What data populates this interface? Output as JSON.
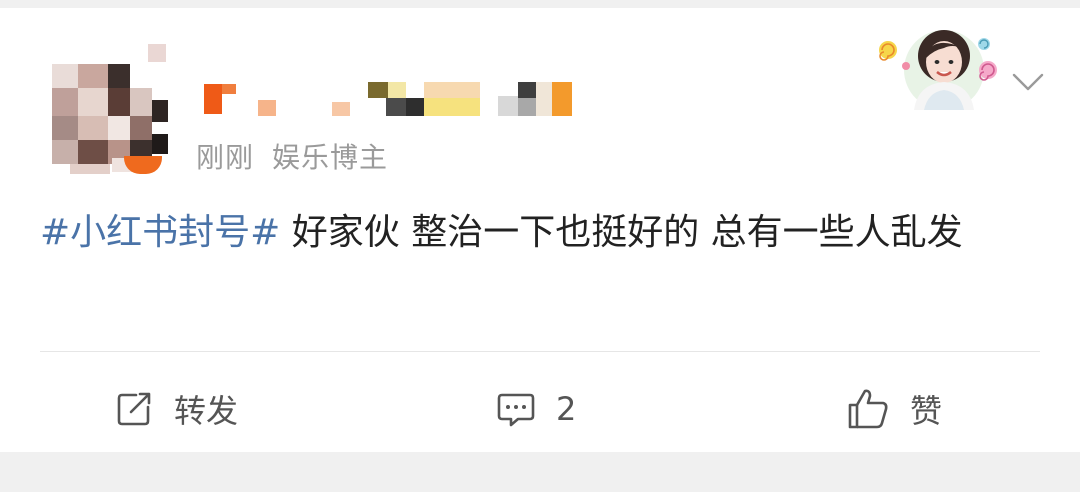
{
  "post": {
    "meta": {
      "time": "刚刚",
      "author_tag": "娱乐博主"
    },
    "text": {
      "hashtag": "#小红书封号#",
      "body": " 好家伙  整治一下也挺好的 总有一些人乱发"
    }
  },
  "actions": {
    "repost_label": "转发",
    "comment_count": "2",
    "like_label": "赞"
  },
  "colors": {
    "hashtag": "#4a73a8",
    "text": "#222222",
    "meta": "#9a9a9a",
    "icon": "#555555",
    "background": "#f0f0f0"
  },
  "icons": {
    "repost": "repost-icon",
    "comment": "comment-icon",
    "like": "thumbs-up-icon",
    "more": "chevron-down-icon"
  }
}
